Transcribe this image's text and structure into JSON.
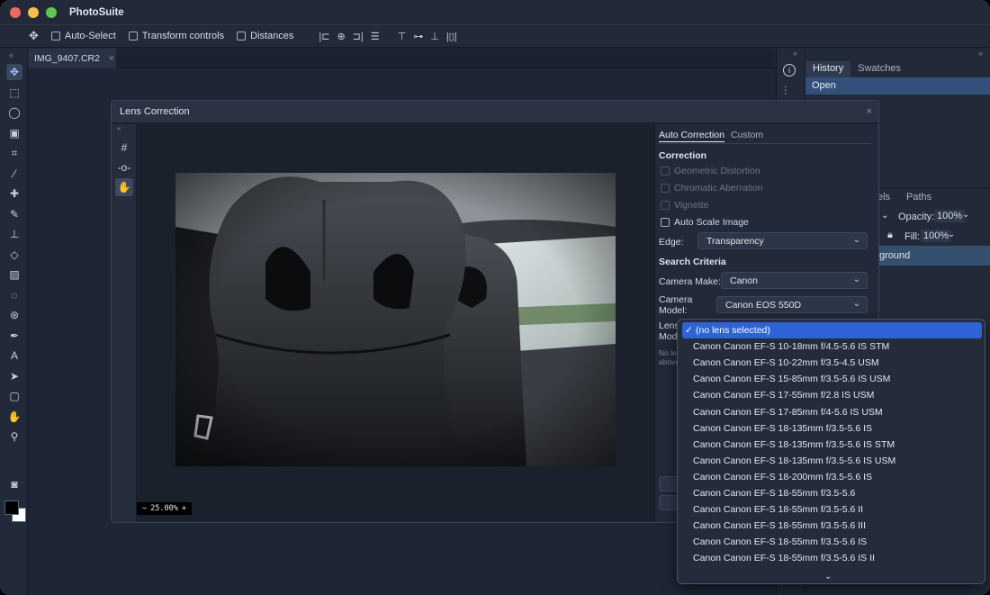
{
  "app": {
    "title": "PhotoSuite"
  },
  "options_bar": {
    "move_icon": "move-arrows-icon",
    "auto_select": "Auto-Select",
    "transform_controls": "Transform controls",
    "distances": "Distances",
    "align_icons": [
      "align-left-icon",
      "align-center-h-icon",
      "align-right-icon",
      "distribute-v-icon",
      "align-top-icon",
      "align-middle-icon",
      "align-bottom-icon",
      "distribute-h-icon"
    ]
  },
  "document": {
    "tab_name": "IMG_9407.CR2",
    "close_glyph": "×"
  },
  "toolbar": {
    "collapse": "«",
    "tools": [
      "move",
      "marquee",
      "lasso",
      "quick-select",
      "crop",
      "eyedropper",
      "healing",
      "brush",
      "stamp",
      "eraser",
      "gradient",
      "blur",
      "dodge",
      "pen",
      "type",
      "path-select",
      "shape",
      "hand",
      "zoom"
    ]
  },
  "right_panel": {
    "collapse_left": "«",
    "collapse_right": "»",
    "tabs": [
      "History",
      "Swatches"
    ],
    "history_items": [
      "Open"
    ],
    "layers_tabs": [
      "els",
      "Paths"
    ],
    "opacity_label": "Opacity:",
    "opacity_value": "100%",
    "fill_label": "Fill:",
    "fill_value": "100%",
    "layer_name": "ground"
  },
  "dialog": {
    "title": "Lens Correction",
    "close_glyph": "×",
    "collapse": "«",
    "zoom": {
      "minus": "−",
      "value": "25.00%",
      "plus": "+"
    },
    "tabs": [
      "Auto Correction",
      "Custom"
    ],
    "correction_title": "Correction",
    "checks": {
      "geometric": "Geometric Distortion",
      "chromatic": "Chromatic Aberration",
      "vignette": "Vignette",
      "auto_scale": "Auto Scale Image"
    },
    "edge_label": "Edge:",
    "edge_value": "Transparency",
    "search_title": "Search Criteria",
    "camera_make_label": "Camera Make:",
    "camera_make_value": "Canon",
    "camera_model_label_1": "Camera",
    "camera_model_label_2": "Model:",
    "camera_model_value": "Canon EOS 550D",
    "lens_model_label_1": "Lens",
    "lens_model_label_2": "Mod",
    "note_1": "No le",
    "note_2": "above"
  },
  "dropdown": {
    "check": "✓",
    "more": "⌄",
    "items": [
      "(no lens selected)",
      "Canon Canon EF-S 10-18mm f/4.5-5.6 IS STM",
      "Canon Canon EF-S 10-22mm f/3.5-4.5 USM",
      "Canon Canon EF-S 15-85mm f/3.5-5.6 IS USM",
      "Canon Canon EF-S 17-55mm f/2.8 IS USM",
      "Canon Canon EF-S 17-85mm f/4-5.6 IS USM",
      "Canon Canon EF-S 18-135mm f/3.5-5.6 IS",
      "Canon Canon EF-S 18-135mm f/3.5-5.6 IS STM",
      "Canon Canon EF-S 18-135mm f/3.5-5.6 IS USM",
      "Canon Canon EF-S 18-200mm f/3.5-5.6 IS",
      "Canon Canon EF-S 18-55mm f/3.5-5.6",
      "Canon Canon EF-S 18-55mm f/3.5-5.6 II",
      "Canon Canon EF-S 18-55mm f/3.5-5.6 III",
      "Canon Canon EF-S 18-55mm f/3.5-5.6 IS",
      "Canon Canon EF-S 18-55mm f/3.5-5.6 IS II"
    ],
    "selected_index": 0
  },
  "colors": {
    "accent": "#2e63d6",
    "panel": "#222a3a",
    "canvas": "#1e2636"
  }
}
